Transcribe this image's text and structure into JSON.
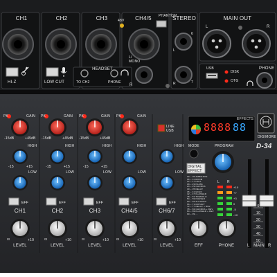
{
  "channels": {
    "top_labels": [
      "CH1",
      "CH2",
      "CH3",
      "CH4/5"
    ],
    "bottom_labels": [
      "CH1",
      "CH2",
      "CH3",
      "CH4/5",
      "CH6/7"
    ],
    "level_label": "LEVEL",
    "gain_label": "GAIN",
    "high_label": "HIGH",
    "low_label": "LOW",
    "eff_label": "EFF",
    "pk_label": "PK",
    "gain_min": "-15dB",
    "gain_max": "+45dB",
    "eq_min": "-15",
    "eq_max": "+15",
    "level_min": "∞",
    "level_max": "+10"
  },
  "rear_panel": {
    "phantom_label": "PHANTOM",
    "volt_label": "48V",
    "stereo_label": "STEREO",
    "main_out_label": "MAIN OUT",
    "left": "L",
    "right": "R",
    "l_mono": "L/\nMONO",
    "jack6": "6",
    "jack7": "7",
    "hiz_label": "HI-Z",
    "low_cut_label": "LOW CUT",
    "headset_label": "HEADSET",
    "to_ch2_label": "TO CH2",
    "phone_jack_label": "PHONE",
    "usb_label": "USB",
    "disk_label": "DISK",
    "otg_label": "OTG",
    "phone_out_label": "PHONE"
  },
  "dsp": {
    "line_label": "LINE",
    "usb_label": "USB",
    "effects_label": "EFFECTS",
    "display_digits": "8888",
    "program_digits": "88",
    "mode_label": "MODE",
    "program_label": "PROGRAM",
    "digital_effect_label": "DIGITAL\nEFFECT",
    "model": "D-34",
    "brand_mark": "DIGIMORE",
    "effect_list": [
      "00 ~ 05 AMBIENCE",
      "06 ~ 11 ROOM",
      "12 ~ 17 HALL",
      "18 ~ 23 PLATE",
      "24 ~ 29 CHORUS",
      "30 ~ 35 DELAY",
      "36 ~ 41 ECHO",
      "42 ~ 47 FLANGER",
      "48 ~ 53 TREMOLO",
      "54 ~ 59 PHASER",
      "60 ~ 65 AUTOPAN",
      "66 ~ 71 ROTARY",
      "72 ~ 77 DELAY + REV",
      "78 ~ 83 CHORUS + REV",
      "84 ~ 89 FLANGER + REV",
      "90 ~ 99 ..."
    ]
  },
  "master": {
    "eff_label": "EFF",
    "phone_label": "PHONE",
    "main_l": "L",
    "main_label": "MAIN",
    "main_r": "R",
    "meter_l": "L",
    "meter_r": "R",
    "meter_ticks": [
      "+10",
      "+7",
      "+3",
      "0",
      "-5",
      "-10"
    ],
    "fader_scale": [
      "0",
      "10",
      "20",
      "30",
      "40",
      "50"
    ]
  },
  "colors": {
    "panel": "#2a2b2e",
    "rear": "#1b1c1e",
    "gain_knob": "#d8332c",
    "eq_knob": "#2c8ad8",
    "level_knob": "#e6e6e6",
    "led_red": "#ff2a1a",
    "led_green": "#36d43a",
    "display_blue": "#38a8ff",
    "display_red": "#ff3b2a"
  }
}
